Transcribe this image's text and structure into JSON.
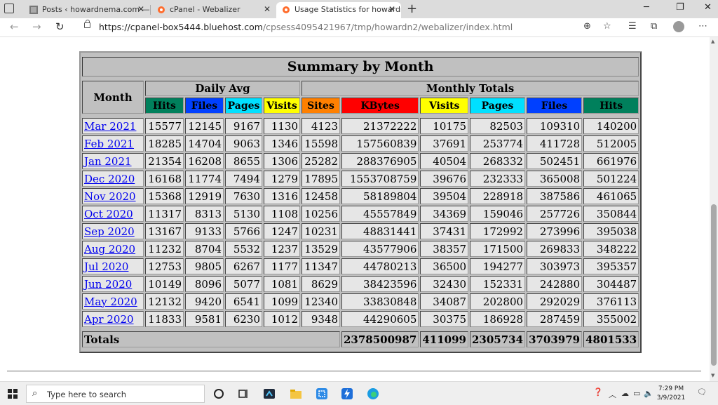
{
  "browser": {
    "tabs": [
      {
        "title": "Posts ‹ howardnema.com — Wo…",
        "active": false
      },
      {
        "title": "cPanel - Webalizer",
        "active": false
      },
      {
        "title": "Usage Statistics for howardnema…",
        "active": true
      }
    ],
    "url_host": "https://cpanel-box5444.bluehost.com",
    "url_path": "/cpsess4095421967/tmp/howardn2/webalizer/index.html"
  },
  "summary": {
    "title": "Summary by Month",
    "month_header": "Month",
    "daily_avg_header": "Daily Avg",
    "monthly_totals_header": "Monthly Totals",
    "columns": {
      "hits": "Hits",
      "files": "Files",
      "pages": "Pages",
      "visits": "Visits",
      "sites": "Sites",
      "kbytes": "KBytes"
    },
    "column_colors": {
      "hits": "#00805c",
      "files": "#0040ff",
      "pages": "#00e0ff",
      "visits": "#ffff00",
      "sites": "#ff8000",
      "kbytes": "#ff0000"
    },
    "rows": [
      [
        "Mar 2021",
        "15577",
        "12145",
        "9167",
        "1130",
        "4123",
        "21372222",
        "10175",
        "82503",
        "109310",
        "140200"
      ],
      [
        "Feb 2021",
        "18285",
        "14704",
        "9063",
        "1346",
        "15598",
        "157560839",
        "37691",
        "253774",
        "411728",
        "512005"
      ],
      [
        "Jan 2021",
        "21354",
        "16208",
        "8655",
        "1306",
        "25282",
        "288376905",
        "40504",
        "268332",
        "502451",
        "661976"
      ],
      [
        "Dec 2020",
        "16168",
        "11774",
        "7494",
        "1279",
        "17895",
        "1553708759",
        "39676",
        "232333",
        "365008",
        "501224"
      ],
      [
        "Nov 2020",
        "15368",
        "12919",
        "7630",
        "1316",
        "12458",
        "58189804",
        "39504",
        "228918",
        "387586",
        "461065"
      ],
      [
        "Oct 2020",
        "11317",
        "8313",
        "5130",
        "1108",
        "10256",
        "45557849",
        "34369",
        "159046",
        "257726",
        "350844"
      ],
      [
        "Sep 2020",
        "13167",
        "9133",
        "5766",
        "1247",
        "10231",
        "48831441",
        "37431",
        "172992",
        "273996",
        "395038"
      ],
      [
        "Aug 2020",
        "11232",
        "8704",
        "5532",
        "1237",
        "13529",
        "43577906",
        "38357",
        "171500",
        "269833",
        "348222"
      ],
      [
        "Jul 2020",
        "12753",
        "9805",
        "6267",
        "1177",
        "11347",
        "44780213",
        "36500",
        "194277",
        "303973",
        "395357"
      ],
      [
        "Jun 2020",
        "10149",
        "8096",
        "5077",
        "1081",
        "8629",
        "38423596",
        "32430",
        "152331",
        "242880",
        "304487"
      ],
      [
        "May 2020",
        "12132",
        "9420",
        "6541",
        "1099",
        "12340",
        "33830848",
        "34087",
        "202800",
        "292029",
        "376113"
      ],
      [
        "Apr 2020",
        "11833",
        "9581",
        "6230",
        "1012",
        "9348",
        "44290605",
        "30375",
        "186928",
        "287459",
        "355002"
      ]
    ],
    "totals": {
      "label": "Totals",
      "kbytes": "2378500987",
      "visits": "411099",
      "pages": "2305734",
      "files": "3703979",
      "hits": "4801533"
    }
  },
  "taskbar": {
    "search_placeholder": "Type here to search",
    "time": "7:29 PM",
    "date": "3/9/2021"
  }
}
